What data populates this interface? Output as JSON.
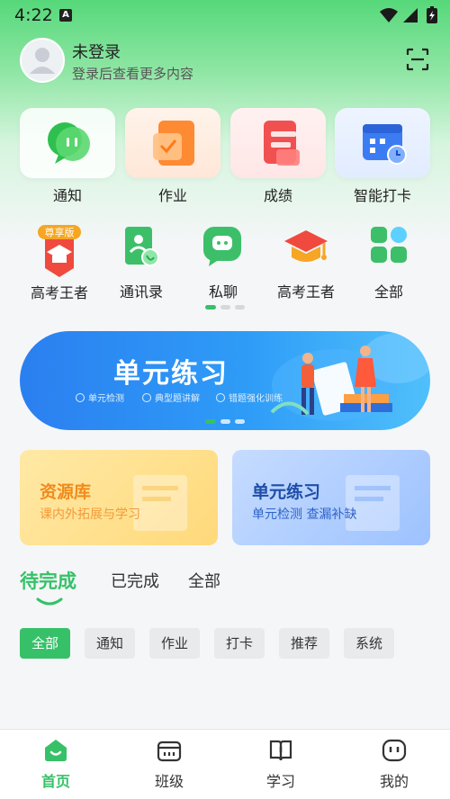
{
  "status_bar": {
    "time": "4:22",
    "notif_glyph": "A"
  },
  "header": {
    "name": "未登录",
    "subtitle": "登录后查看更多内容"
  },
  "main_grid": [
    {
      "label": "通知",
      "icon": "chat-bubble-icon"
    },
    {
      "label": "作业",
      "icon": "homework-icon"
    },
    {
      "label": "成绩",
      "icon": "score-icon"
    },
    {
      "label": "智能打卡",
      "icon": "calendar-clock-icon"
    }
  ],
  "secondary_grid": [
    {
      "label": "高考王者",
      "badge": "尊享版",
      "icon": "cap-vip-icon"
    },
    {
      "label": "通讯录",
      "icon": "contacts-icon"
    },
    {
      "label": "私聊",
      "icon": "private-chat-icon"
    },
    {
      "label": "高考王者",
      "icon": "graduation-cap-icon"
    },
    {
      "label": "全部",
      "icon": "grid-all-icon"
    }
  ],
  "banner": {
    "title": "单元练习",
    "features": [
      "单元检测",
      "典型题讲解",
      "错题强化训练"
    ]
  },
  "cards": [
    {
      "title": "资源库",
      "subtitle": "课内外拓展与学习",
      "title_color": "#f08b1d",
      "subtitle_color": "#f29a3a"
    },
    {
      "title": "单元练习",
      "subtitle": "单元检测  查漏补缺",
      "title_color": "#1f4ea8",
      "subtitle_color": "#2e63c8"
    }
  ],
  "tasks_tabs": [
    "待完成",
    "已完成",
    "全部"
  ],
  "filter_chips": [
    "全部",
    "通知",
    "作业",
    "打卡",
    "推荐",
    "系统"
  ],
  "bottom_nav": [
    {
      "label": "首页",
      "active": true
    },
    {
      "label": "班级",
      "active": false
    },
    {
      "label": "学习",
      "active": false
    },
    {
      "label": "我的",
      "active": false
    }
  ],
  "colors": {
    "accent": "#36c168",
    "banner": "#2e8ff4"
  }
}
